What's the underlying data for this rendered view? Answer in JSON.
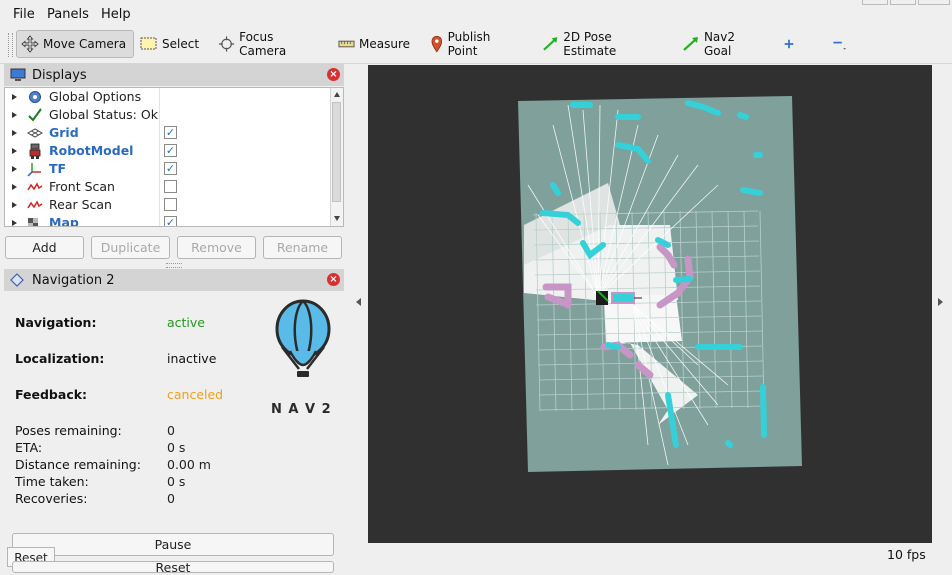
{
  "menu": {
    "file": "File",
    "panels": "Panels",
    "help": "Help"
  },
  "toolbar": {
    "move_camera": "Move Camera",
    "select": "Select",
    "focus_camera": "Focus Camera",
    "measure": "Measure",
    "publish_point": "Publish Point",
    "pose_estimate": "2D Pose Estimate",
    "nav2_goal": "Nav2 Goal"
  },
  "displays": {
    "title": "Displays",
    "items": [
      {
        "label": "Global Options",
        "checked": null,
        "bold": false
      },
      {
        "label": "Global Status: Ok",
        "checked": null,
        "bold": false
      },
      {
        "label": "Grid",
        "checked": true,
        "bold": true
      },
      {
        "label": "RobotModel",
        "checked": true,
        "bold": true
      },
      {
        "label": "TF",
        "checked": true,
        "bold": true
      },
      {
        "label": "Front Scan",
        "checked": false,
        "bold": false
      },
      {
        "label": "Rear Scan",
        "checked": false,
        "bold": false
      },
      {
        "label": "Map",
        "checked": true,
        "bold": true
      }
    ],
    "buttons": {
      "add": "Add",
      "duplicate": "Duplicate",
      "remove": "Remove",
      "rename": "Rename"
    }
  },
  "nav2": {
    "title": "Navigation 2",
    "navigation_label": "Navigation:",
    "navigation_value": "active",
    "localization_label": "Localization:",
    "localization_value": "inactive",
    "feedback_label": "Feedback:",
    "feedback_value": "canceled",
    "poses_label": "Poses remaining:",
    "poses_value": "0",
    "eta_label": "ETA:",
    "eta_value": "0 s",
    "distance_label": "Distance remaining:",
    "distance_value": "0.00 m",
    "time_label": "Time taken:",
    "time_value": "0 s",
    "recoveries_label": "Recoveries:",
    "recoveries_value": "0",
    "logo_text": "N A V 2",
    "pause_button": "Pause",
    "reset_button": "Reset",
    "partial_button": "Reset"
  },
  "status": {
    "fps": "10 fps"
  },
  "colors": {
    "active": "#1f9a1f",
    "canceled": "#f0a020",
    "map_free": "#f7f7f7",
    "map_unknown": "#7fa09b",
    "costmap": "#35d1d8",
    "inflation": "#c796c6",
    "viewport_bg": "#303030"
  }
}
